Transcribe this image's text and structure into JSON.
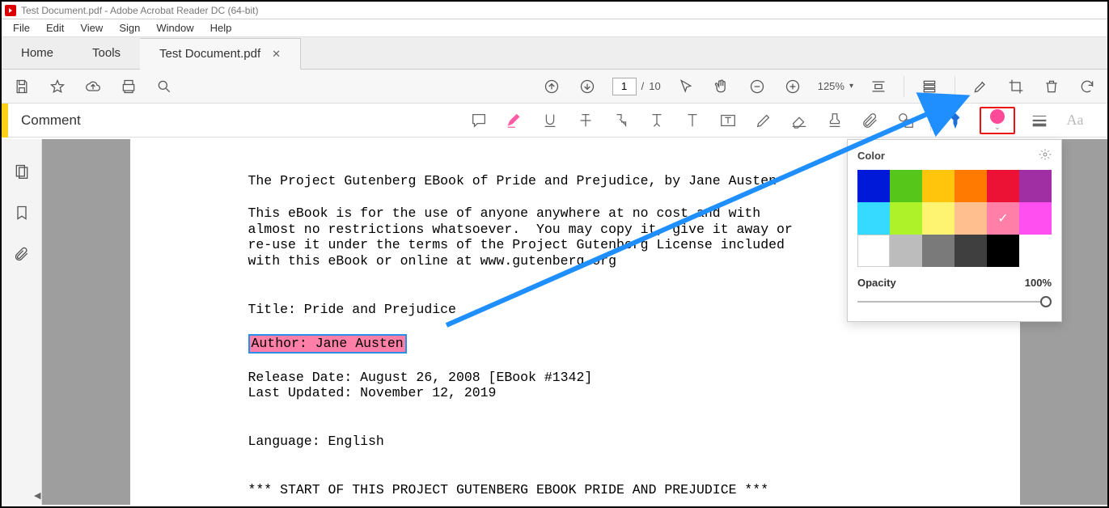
{
  "title": "Test Document.pdf - Adobe Acrobat Reader DC (64-bit)",
  "menu": {
    "file": "File",
    "edit": "Edit",
    "view": "View",
    "sign": "Sign",
    "window": "Window",
    "help": "Help"
  },
  "tabs": {
    "home": "Home",
    "tools": "Tools",
    "doc": "Test Document.pdf"
  },
  "page_current": "1",
  "page_sep": "/",
  "page_total": "10",
  "zoom": "125%",
  "comment_label": "Comment",
  "colorpanel": {
    "title": "Color",
    "opacity_label": "Opacity",
    "opacity_value": "100%",
    "colors": [
      "#0018d8",
      "#56c71a",
      "#ffc50c",
      "#ff7a00",
      "#eb1235",
      "#a02fa4",
      "#36d9ff",
      "#aef22a",
      "#fff471",
      "#ffbf8e",
      "#ff7fa8",
      "#ff4ff1",
      "#ffffff",
      "#bcbcbc",
      "#7a7a7a",
      "#3f3f3f",
      "#000000"
    ],
    "selected_index": 10
  },
  "doc": {
    "l1": "The Project Gutenberg EBook of Pride and Prejudice, by Jane Austen",
    "l2": "This eBook is for the use of anyone anywhere at no cost and with",
    "l3": "almost no restrictions whatsoever.  You may copy it, give it away or",
    "l4": "re-use it under the terms of the Project Gutenberg License included",
    "l5": "with this eBook or online at www.gutenberg.org",
    "l6": "Title: Pride and Prejudice",
    "l7": "Author: Jane Austen",
    "l8": "Release Date: August 26, 2008 [EBook #1342]",
    "l9": "Last Updated: November 12, 2019",
    "l10": "Language: English",
    "l11": "*** START OF THIS PROJECT GUTENBERG EBOOK PRIDE AND PREJUDICE ***"
  }
}
